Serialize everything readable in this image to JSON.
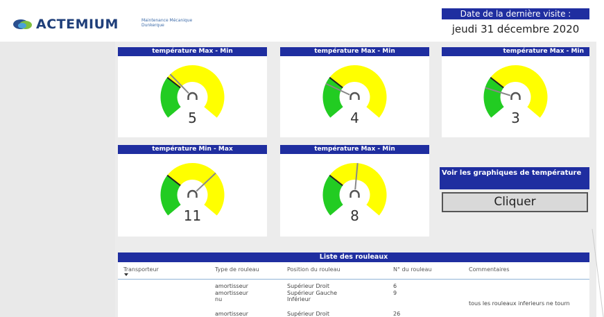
{
  "header": {
    "logo_text": "ACTEMIUM",
    "subtitle_line1": "Maintenance Mécanique",
    "subtitle_line2": "Dunkerque",
    "visit_title": "Date de la dernière visite :",
    "visit_date": "jeudi 31 décembre 2020"
  },
  "colors": {
    "accent": "#1f2ea0",
    "gauge_green": "#22cc22",
    "gauge_yellow": "#ffff00",
    "logo_blue": "#1f3f7a"
  },
  "gauges": [
    {
      "title": "température Max - Min",
      "value": "5",
      "level": 0.33
    },
    {
      "title": "température Max - Min",
      "value": "4",
      "level": 0.25
    },
    {
      "title": "température Max - Min",
      "value": "3",
      "level": 0.22
    },
    {
      "title": "température Min - Max",
      "value": "11",
      "level": 0.68
    },
    {
      "title": "température Max - Min",
      "value": "8",
      "level": 0.52
    }
  ],
  "action": {
    "title": "Voir les graphiques de température",
    "button_label": "Cliquer"
  },
  "table": {
    "title": "Liste des rouleaux",
    "headers": [
      "Transporteur",
      "Type de rouleau",
      "Position du rouleau",
      "N° du rouleau",
      "Commentaires"
    ],
    "rows": [
      {
        "type": "amortisseur",
        "position": "Supérieur Droit",
        "numero": "6",
        "commentaire": ""
      },
      {
        "type": "amortisseur",
        "position": "Supérieur Gauche",
        "numero": "9",
        "commentaire": ""
      },
      {
        "type": "nu",
        "position": "Inférieur",
        "numero": "",
        "commentaire": "tous les rouleaux inferieurs ne tourn"
      },
      {
        "type": "amortisseur",
        "position": "Supérieur Droit",
        "numero": "26",
        "commentaire": ""
      }
    ]
  }
}
